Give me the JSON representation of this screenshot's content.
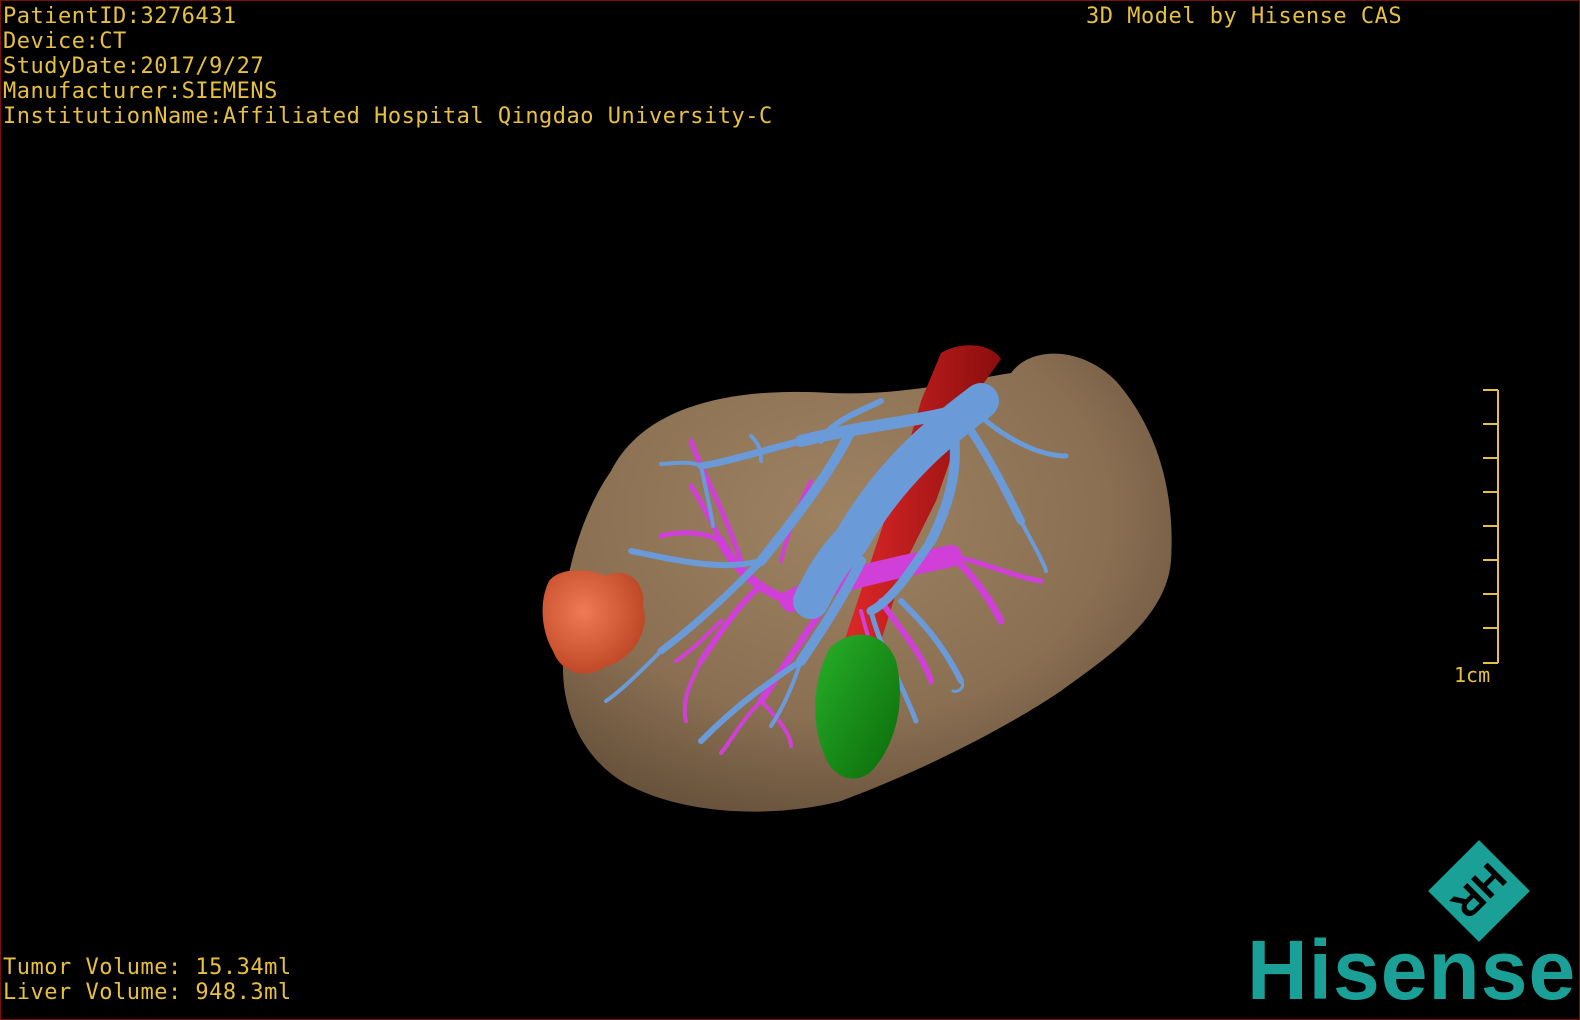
{
  "study_info": {
    "patient_id": "PatientID:3276431",
    "device": "Device:CT",
    "study_date": "StudyDate:2017/9/27",
    "manufacturer": "Manufacturer:SIEMENS",
    "institution": "InstitutionName:Affiliated Hospital Qingdao University-C"
  },
  "credit": "3D Model by Hisense CAS",
  "volumes": {
    "tumor": "Tumor Volume: 15.34ml",
    "liver": "Liver Volume: 948.3ml"
  },
  "scale_bar": {
    "label": "1cm"
  },
  "logo": {
    "brand_text": "Hisense",
    "badge_letters": "HR",
    "color": "#1aa097"
  },
  "colors": {
    "overlay_text": "#e8c040",
    "liver": "#8a6f52",
    "portal_vein": "#6a9ad8",
    "hepatic_artery_branches": "#d040d8",
    "vena_cava": "#c01818",
    "tumor": "#e05a38",
    "gallbladder": "#1a9a1a",
    "background": "#000000"
  }
}
